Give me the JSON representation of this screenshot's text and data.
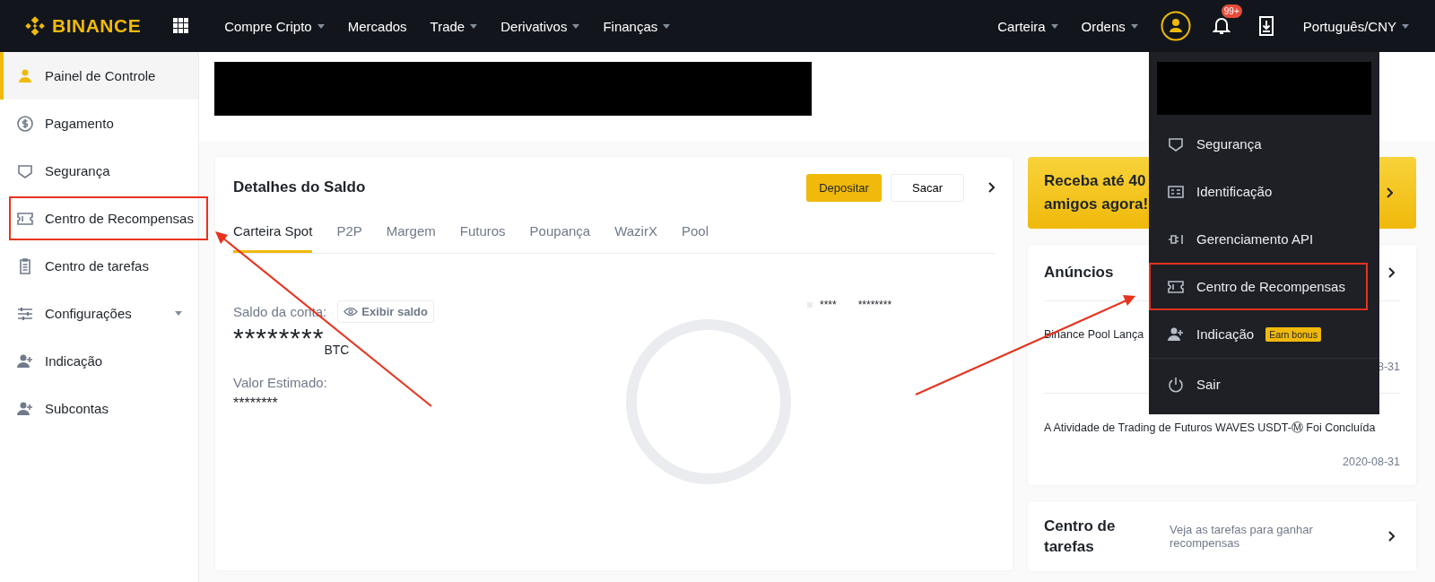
{
  "topbar": {
    "logo": "BINANCE",
    "nav": [
      {
        "label": "Compre Cripto",
        "dropdown": true
      },
      {
        "label": "Mercados",
        "dropdown": false
      },
      {
        "label": "Trade",
        "dropdown": true
      },
      {
        "label": "Derivativos",
        "dropdown": true
      },
      {
        "label": "Finanças",
        "dropdown": true
      }
    ],
    "right_nav": [
      {
        "label": "Carteira",
        "dropdown": true
      },
      {
        "label": "Ordens",
        "dropdown": true
      }
    ],
    "notification_badge": "99+",
    "language": {
      "label": "Português/CNY",
      "dropdown": true
    }
  },
  "sidebar": {
    "items": [
      {
        "label": "Painel de Controle",
        "kind": "user",
        "selected": true,
        "highlighted": false,
        "dropdown": false
      },
      {
        "label": "Pagamento",
        "kind": "dollar",
        "selected": false,
        "highlighted": false,
        "dropdown": false
      },
      {
        "label": "Segurança",
        "kind": "shield",
        "selected": false,
        "highlighted": false,
        "dropdown": false
      },
      {
        "label": "Centro de Recompensas",
        "kind": "ticket",
        "selected": false,
        "highlighted": true,
        "dropdown": false
      },
      {
        "label": "Centro de tarefas",
        "kind": "clipboard",
        "selected": false,
        "highlighted": false,
        "dropdown": false
      },
      {
        "label": "Configurações",
        "kind": "sliders",
        "selected": false,
        "highlighted": false,
        "dropdown": true
      },
      {
        "label": "Indicação",
        "kind": "user-plus",
        "selected": false,
        "highlighted": false,
        "dropdown": false
      },
      {
        "label": "Subcontas",
        "kind": "user-plus",
        "selected": false,
        "highlighted": false,
        "dropdown": false
      }
    ]
  },
  "balance": {
    "title": "Detalhes do Saldo",
    "buttons": [
      {
        "label": "Depositar",
        "kind": "primary"
      },
      {
        "label": "Sacar",
        "kind": "secondary"
      }
    ],
    "tabs": [
      {
        "label": "Carteira Spot",
        "selected": true
      },
      {
        "label": "P2P",
        "selected": false
      },
      {
        "label": "Margem",
        "selected": false
      },
      {
        "label": "Futuros",
        "selected": false
      },
      {
        "label": "Poupança",
        "selected": false
      },
      {
        "label": "WazirX",
        "selected": false
      },
      {
        "label": "Pool",
        "selected": false
      }
    ],
    "account_label": "Saldo da conta:",
    "show_balance": "Exibir saldo",
    "account_value": "********",
    "account_unit": "BTC",
    "estimated_label": "Valor Estimado:",
    "estimated_value": "********",
    "legend": {
      "name": "****",
      "value": "********"
    }
  },
  "promo": {
    "lines": [
      "Receba até 40",
      "amigos agora!"
    ]
  },
  "announcements": {
    "title": "Anúncios",
    "items": [
      {
        "text": "Binance Pool Lança",
        "date": "8-31"
      },
      {
        "text": "A Atividade de Trading de Futuros WAVES USDT-Ⓜ Foi Concluída",
        "date": "2020-08-31"
      }
    ]
  },
  "tasks": {
    "title": "Centro de tarefas",
    "text": "Veja as tarefas para ganhar recompensas"
  },
  "user_menu": {
    "items": [
      {
        "label": "Segurança",
        "kind": "shield",
        "highlighted": false,
        "divider_before": false
      },
      {
        "label": "Identificação",
        "kind": "id-card",
        "highlighted": false,
        "divider_before": false
      },
      {
        "label": "Gerenciamento API",
        "kind": "plug",
        "highlighted": false,
        "divider_before": false
      },
      {
        "label": "Centro de Recompensas",
        "kind": "ticket",
        "highlighted": true,
        "divider_before": false
      },
      {
        "label": "Indicação",
        "kind": "user-plus",
        "highlighted": false,
        "divider_before": false,
        "badge": "Earn bonus"
      },
      {
        "label": "Sair",
        "kind": "power",
        "highlighted": false,
        "divider_before": true
      }
    ]
  }
}
